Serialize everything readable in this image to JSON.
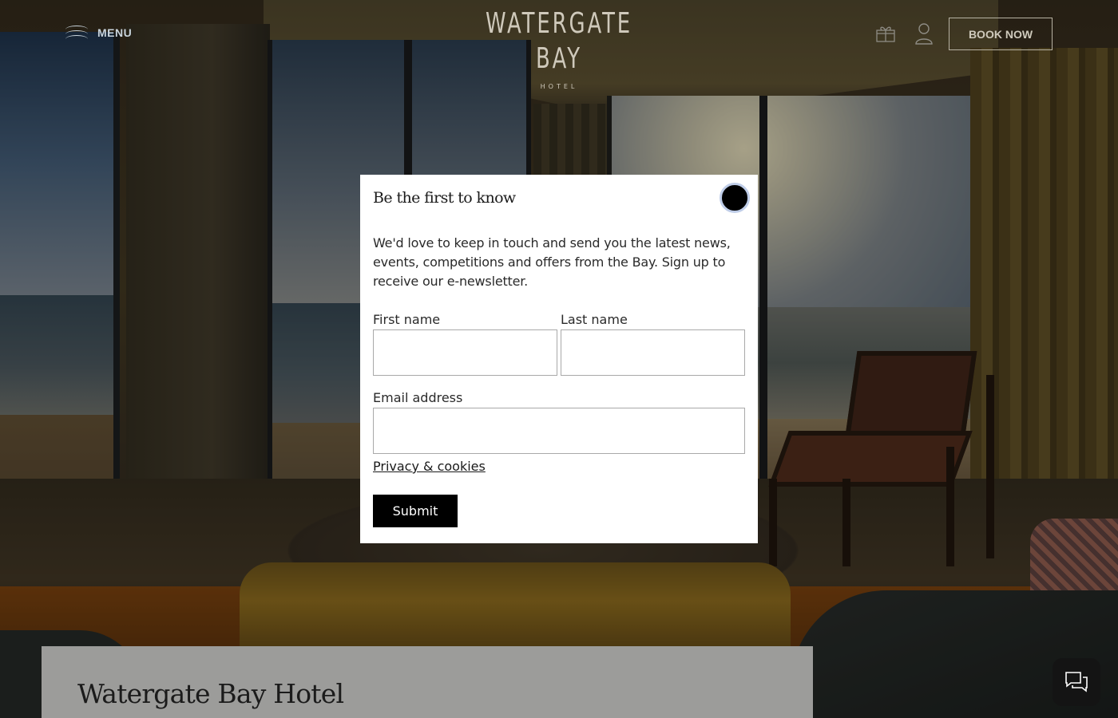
{
  "header": {
    "menu_label": "MENU",
    "logo_main": "WATERGATE BAY",
    "logo_sub": "HOTEL",
    "book_label": "BOOK NOW",
    "icons": [
      "gift-icon",
      "user-icon"
    ]
  },
  "modal": {
    "title": "Be the first to know",
    "text": "We'd love to keep in touch and send you the latest news, events, competitions and offers from the Bay. Sign up to receive our e-newsletter.",
    "first_name_label": "First name",
    "first_name_value": "",
    "last_name_label": "Last name",
    "last_name_value": "",
    "email_label": "Email address",
    "email_value": "",
    "privacy_link": "Privacy & cookies",
    "submit_label": "Submit"
  },
  "page": {
    "hotel_title": "Watergate Bay Hotel"
  },
  "chat": {
    "icon": "chat-icon"
  },
  "colors": {
    "modal_bg": "#ffffff",
    "button_bg": "#000000",
    "close_ring": "#bfcde8"
  }
}
